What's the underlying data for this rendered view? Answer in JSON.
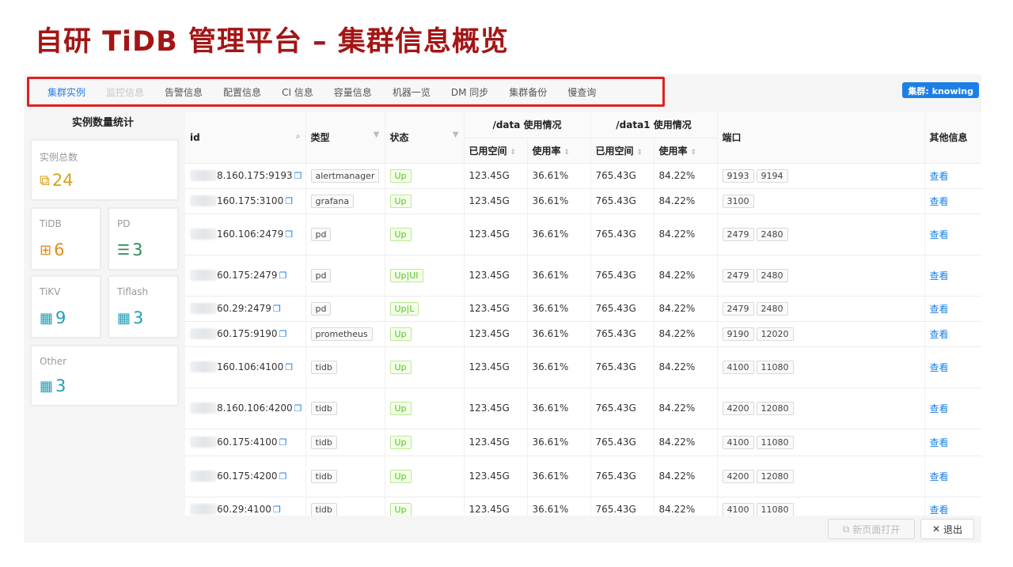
{
  "slide_title": "自研 TiDB 管理平台 – 集群信息概览",
  "tabs": [
    {
      "label": "集群实例",
      "state": "active"
    },
    {
      "label": "监控信息",
      "state": "disabled"
    },
    {
      "label": "告警信息",
      "state": "normal"
    },
    {
      "label": "配置信息",
      "state": "normal"
    },
    {
      "label": "CI 信息",
      "state": "normal"
    },
    {
      "label": "容量信息",
      "state": "normal"
    },
    {
      "label": "机器一览",
      "state": "normal"
    },
    {
      "label": "DM 同步",
      "state": "normal"
    },
    {
      "label": "集群备份",
      "state": "normal"
    },
    {
      "label": "慢查询",
      "state": "normal"
    }
  ],
  "cluster_badge": "集群: knowing",
  "stats": {
    "title": "实例数量统计",
    "total": {
      "label": "实例总数",
      "value": "24",
      "icon": "topology-icon"
    },
    "tidb": {
      "label": "TiDB",
      "value": "6",
      "icon": "server-icon"
    },
    "pd": {
      "label": "PD",
      "value": "3",
      "icon": "list-icon"
    },
    "tikv": {
      "label": "TiKV",
      "value": "9",
      "icon": "grid-icon"
    },
    "tiflash": {
      "label": "Tiflash",
      "value": "3",
      "icon": "grid-icon"
    },
    "other": {
      "label": "Other",
      "value": "3",
      "icon": "grid-icon"
    }
  },
  "table": {
    "headers": {
      "id": "id",
      "type": "类型",
      "status": "状态",
      "data_group": "/data 使用情况",
      "data1_group": "/data1 使用情况",
      "used_space": "已用空间",
      "usage_rate": "使用率",
      "port": "端口",
      "other_info": "其他信息"
    },
    "rows": [
      {
        "id": "8.160.175:9193",
        "type": "alertmanager",
        "status": "Up",
        "data_used": "123.45G",
        "data_rate": "36.61%",
        "data1_used": "765.43G",
        "data1_rate": "84.22%",
        "ports": [
          "9193",
          "9194"
        ],
        "action": "查看"
      },
      {
        "id": "160.175:3100",
        "type": "grafana",
        "status": "Up",
        "data_used": "123.45G",
        "data_rate": "36.61%",
        "data1_used": "765.43G",
        "data1_rate": "84.22%",
        "ports": [
          "3100"
        ],
        "action": "查看"
      },
      {
        "id": "160.106:2479",
        "type": "pd",
        "status": "Up",
        "data_used": "123.45G",
        "data_rate": "36.61%",
        "data1_used": "765.43G",
        "data1_rate": "84.22%",
        "ports": [
          "2479",
          "2480"
        ],
        "action": "查看"
      },
      {
        "id": "60.175:2479",
        "type": "pd",
        "status": "Up|UI",
        "data_used": "123.45G",
        "data_rate": "36.61%",
        "data1_used": "765.43G",
        "data1_rate": "84.22%",
        "ports": [
          "2479",
          "2480"
        ],
        "action": "查看"
      },
      {
        "id": "60.29:2479",
        "type": "pd",
        "status": "Up|L",
        "data_used": "123.45G",
        "data_rate": "36.61%",
        "data1_used": "765.43G",
        "data1_rate": "84.22%",
        "ports": [
          "2479",
          "2480"
        ],
        "action": "查看"
      },
      {
        "id": "60.175:9190",
        "type": "prometheus",
        "status": "Up",
        "data_used": "123.45G",
        "data_rate": "36.61%",
        "data1_used": "765.43G",
        "data1_rate": "84.22%",
        "ports": [
          "9190",
          "12020"
        ],
        "action": "查看"
      },
      {
        "id": "160.106:4100",
        "type": "tidb",
        "status": "Up",
        "data_used": "123.45G",
        "data_rate": "36.61%",
        "data1_used": "765.43G",
        "data1_rate": "84.22%",
        "ports": [
          "4100",
          "11080"
        ],
        "action": "查看"
      },
      {
        "id": "8.160.106:4200",
        "type": "tidb",
        "status": "Up",
        "data_used": "123.45G",
        "data_rate": "36.61%",
        "data1_used": "765.43G",
        "data1_rate": "84.22%",
        "ports": [
          "4200",
          "12080"
        ],
        "action": "查看"
      },
      {
        "id": "60.175:4100",
        "type": "tidb",
        "status": "Up",
        "data_used": "123.45G",
        "data_rate": "36.61%",
        "data1_used": "765.43G",
        "data1_rate": "84.22%",
        "ports": [
          "4100",
          "11080"
        ],
        "action": "查看"
      },
      {
        "id": "60.175:4200",
        "type": "tidb",
        "status": "Up",
        "data_used": "123.45G",
        "data_rate": "36.61%",
        "data1_used": "765.43G",
        "data1_rate": "84.22%",
        "ports": [
          "4200",
          "12080"
        ],
        "action": "查看"
      },
      {
        "id": "60.29:4100",
        "type": "tidb",
        "status": "Up",
        "data_used": "123.45G",
        "data_rate": "36.61%",
        "data1_used": "765.43G",
        "data1_rate": "84.22%",
        "ports": [
          "4100",
          "11080"
        ],
        "action": "查看"
      }
    ]
  },
  "footer": {
    "new_page_label": "新页面打开",
    "exit_label": "退出"
  }
}
